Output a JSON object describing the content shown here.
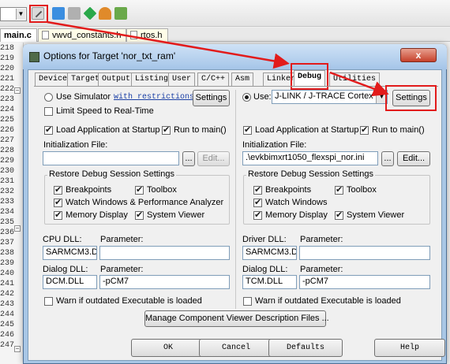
{
  "editor": {
    "tabs": [
      {
        "label": "main.c"
      },
      {
        "label": "vwvd_constants.h"
      },
      {
        "label": "rtos.h"
      }
    ],
    "line_numbers": [
      "218",
      "219",
      "220",
      "221",
      "222",
      "223",
      "224",
      "225",
      "226",
      "227",
      "228",
      "229",
      "230",
      "231",
      "232",
      "233",
      "234",
      "235",
      "236",
      "237",
      "238",
      "239",
      "240",
      "241",
      "242",
      "243",
      "244",
      "245",
      "246",
      "247"
    ]
  },
  "dialog": {
    "title": "Options for Target 'nor_txt_ram'",
    "close_label": "x",
    "tabs": [
      "Device",
      "Target",
      "Output",
      "Listing",
      "User",
      "C/C++",
      "Asm",
      "Linker",
      "Debug",
      "Utilities"
    ],
    "active_tab": "Debug",
    "left": {
      "use_simulator": "Use Simulator",
      "restrictions_link": "with restrictions",
      "settings_label": "Settings",
      "limit_speed": "Limit Speed to Real-Time",
      "load_app": "Load Application at Startup",
      "run_to_main": "Run to main()",
      "init_file_label": "Initialization File:",
      "init_file_value": "",
      "browse_label": "...",
      "edit_label": "Edit...",
      "restore_group": "Restore Debug Session Settings",
      "breakpoints": "Breakpoints",
      "toolbox": "Toolbox",
      "watch": "Watch Windows & Performance Analyzer",
      "memory": "Memory Display",
      "system_viewer": "System Viewer",
      "cpu_dll_label": "CPU DLL:",
      "cpu_dll_value": "SARMCM3.DLL",
      "param_label": "Parameter:",
      "cpu_param_value": "",
      "dialog_dll_label": "Dialog DLL:",
      "dialog_dll_value": "DCM.DLL",
      "dialog_param_value": "-pCM7",
      "warn": "Warn if outdated Executable is loaded"
    },
    "right": {
      "use_label": "Use:",
      "debugger": "J-LINK / J-TRACE Cortex",
      "settings_label": "Settings",
      "load_app": "Load Application at Startup",
      "run_to_main": "Run to main()",
      "init_file_label": "Initialization File:",
      "init_file_value": ".\\evkbimxrt1050_flexspi_nor.ini",
      "browse_label": "...",
      "edit_label": "Edit...",
      "restore_group": "Restore Debug Session Settings",
      "breakpoints": "Breakpoints",
      "toolbox": "Toolbox",
      "watch": "Watch Windows",
      "memory": "Memory Display",
      "system_viewer": "System Viewer",
      "driver_dll_label": "Driver DLL:",
      "driver_dll_value": "SARMCM3.DLL",
      "param_label": "Parameter:",
      "driver_param_value": "",
      "dialog_dll_label": "Dialog DLL:",
      "dialog_dll_value": "TCM.DLL",
      "dialog_param_value": "-pCM7",
      "warn": "Warn if outdated Executable is loaded"
    },
    "manage_label": "Manage Component Viewer Description Files ...",
    "buttons": {
      "ok": "OK",
      "cancel": "Cancel",
      "defaults": "Defaults",
      "help": "Help"
    }
  },
  "colors": {
    "annotation": "#e21b1b",
    "title_bar": "#a9c7e6",
    "link": "#1a3fa5"
  }
}
